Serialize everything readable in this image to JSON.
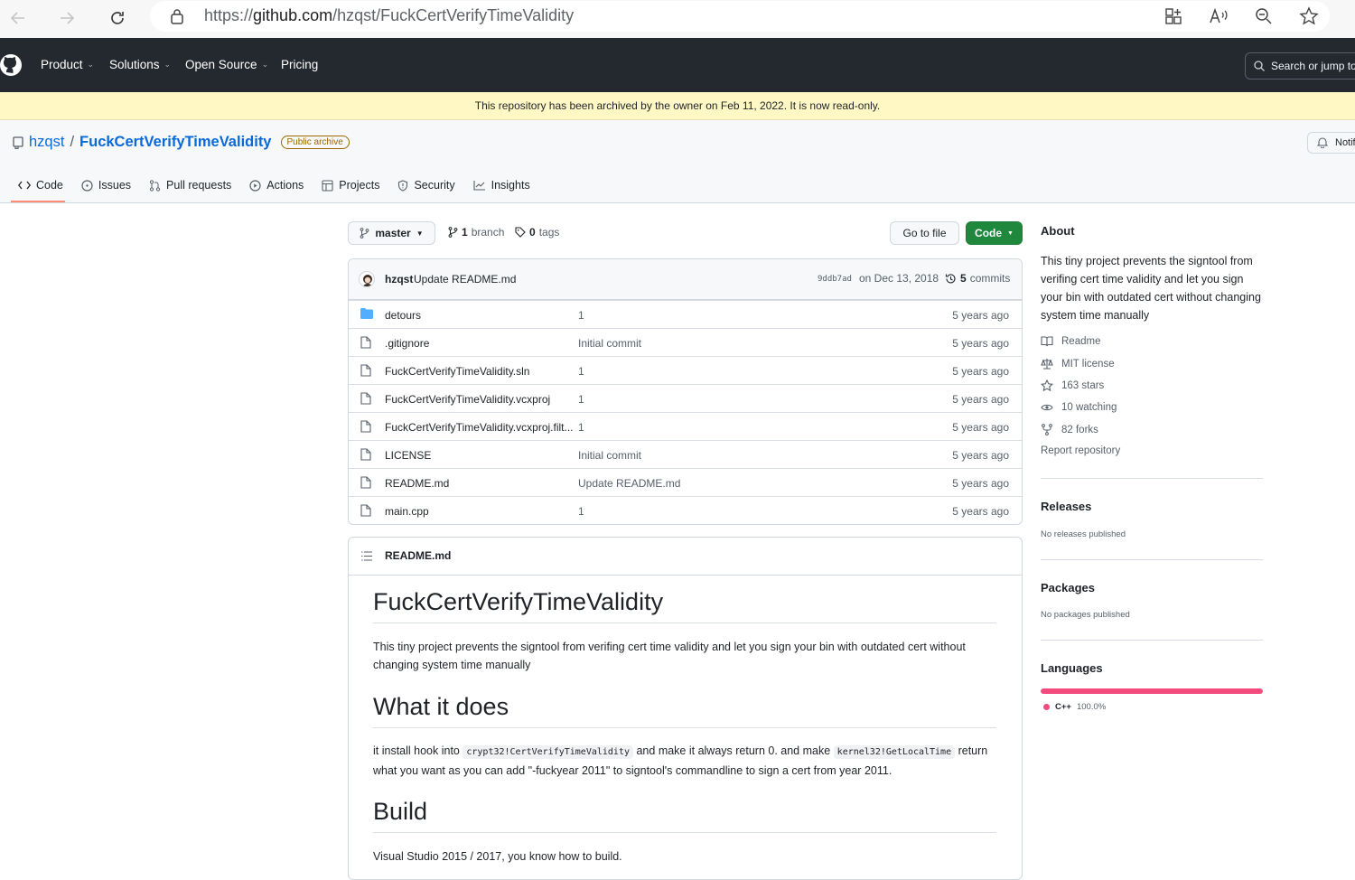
{
  "browser": {
    "url_prefix": "https://",
    "url_host": "github.com",
    "url_path": "/hzqst/FuckCertVerifyTimeValidity"
  },
  "header": {
    "menu": [
      "Product",
      "Solutions",
      "Open Source",
      "Pricing"
    ],
    "search_placeholder": "Search or jump to"
  },
  "archive_banner": "This repository has been archived by the owner on Feb 11, 2022. It is now read-only.",
  "repo": {
    "owner": "hzqst",
    "separator": "/",
    "name": "FuckCertVerifyTimeValidity",
    "badge": "Public archive",
    "notifications_label": "Notifi"
  },
  "tabs": [
    "Code",
    "Issues",
    "Pull requests",
    "Actions",
    "Projects",
    "Security",
    "Insights"
  ],
  "toolbar": {
    "branch": "master",
    "branch_count": "1",
    "branch_label": "branch",
    "tag_count": "0",
    "tag_label": "tags",
    "go_to_file": "Go to file",
    "code_button": "Code"
  },
  "commit": {
    "author": "hzqst",
    "message": "Update README.md",
    "sha": "9ddb7ad",
    "date": "on Dec 13, 2018",
    "count": "5",
    "count_label": "commits"
  },
  "files": [
    {
      "name": "detours",
      "message": "1",
      "age": "5 years ago",
      "type": "dir"
    },
    {
      "name": ".gitignore",
      "message": "Initial commit",
      "age": "5 years ago",
      "type": "file"
    },
    {
      "name": "FuckCertVerifyTimeValidity.sln",
      "message": "1",
      "age": "5 years ago",
      "type": "file"
    },
    {
      "name": "FuckCertVerifyTimeValidity.vcxproj",
      "message": "1",
      "age": "5 years ago",
      "type": "file"
    },
    {
      "name": "FuckCertVerifyTimeValidity.vcxproj.filt...",
      "message": "1",
      "age": "5 years ago",
      "type": "file"
    },
    {
      "name": "LICENSE",
      "message": "Initial commit",
      "age": "5 years ago",
      "type": "file"
    },
    {
      "name": "README.md",
      "message": "Update README.md",
      "age": "5 years ago",
      "type": "file"
    },
    {
      "name": "main.cpp",
      "message": "1",
      "age": "5 years ago",
      "type": "file"
    }
  ],
  "readme": {
    "filename": "README.md",
    "h1": "FuckCertVerifyTimeValidity",
    "intro": "This tiny project prevents the signtool from verifing cert time validity and let you sign your bin with outdated cert without changing system time manually",
    "h2_what": "What it does",
    "what_1": "it install hook into",
    "code_1": "crypt32!CertVerifyTimeValidity",
    "what_2": "and make it always return 0. and make",
    "code_2": "kernel32!GetLocalTime",
    "what_3": "return what you want as you can add \"-fuckyear 2011\" to signtool's commandline to sign a cert from year 2011.",
    "h2_build": "Build",
    "build_text": "Visual Studio 2015 / 2017, you know how to build."
  },
  "sidebar": {
    "about_title": "About",
    "about_text": "This tiny project prevents the signtool from verifing cert time validity and let you sign your bin with outdated cert without changing system time manually",
    "readme": "Readme",
    "license": "MIT license",
    "stars": "163 stars",
    "watching": "10 watching",
    "forks": "82 forks",
    "report": "Report repository",
    "releases_title": "Releases",
    "releases_text": "No releases published",
    "packages_title": "Packages",
    "packages_text": "No packages published",
    "languages_title": "Languages",
    "language_name": "C++",
    "language_pct": "100.0%",
    "language_fraction": 1.0
  },
  "colors": {
    "accent_green": "#1f883d",
    "link_blue": "#0969da",
    "cpp_color": "#f34b7d",
    "folder_blue": "#54aeff"
  }
}
